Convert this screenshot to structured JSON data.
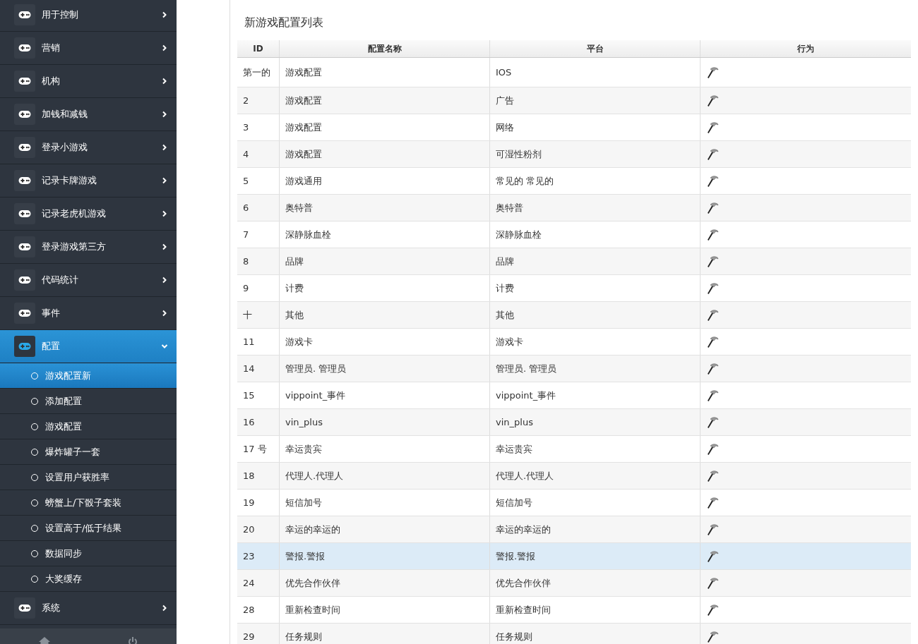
{
  "sidebar": {
    "items": [
      {
        "label": "用于控制",
        "expanded": false,
        "selected": false
      },
      {
        "label": "营销",
        "expanded": false,
        "selected": false
      },
      {
        "label": "机构",
        "expanded": false,
        "selected": false
      },
      {
        "label": "加钱和减钱",
        "expanded": false,
        "selected": false
      },
      {
        "label": "登录小游戏",
        "expanded": false,
        "selected": false
      },
      {
        "label": "记录卡牌游戏",
        "expanded": false,
        "selected": false
      },
      {
        "label": "记录老虎机游戏",
        "expanded": false,
        "selected": false
      },
      {
        "label": "登录游戏第三方",
        "expanded": false,
        "selected": false
      },
      {
        "label": "代码统计",
        "expanded": false,
        "selected": false
      },
      {
        "label": "事件",
        "expanded": false,
        "selected": false
      },
      {
        "label": "配置",
        "expanded": true,
        "selected": true,
        "children": [
          {
            "label": "游戏配置新",
            "selected": true
          },
          {
            "label": "添加配置",
            "selected": false
          },
          {
            "label": "游戏配置",
            "selected": false
          },
          {
            "label": "爆炸罐子一套",
            "selected": false
          },
          {
            "label": "设置用户获胜率",
            "selected": false
          },
          {
            "label": "螃蟹上/下骰子套装",
            "selected": false
          },
          {
            "label": "设置高于/低于结果",
            "selected": false
          },
          {
            "label": "数据同步",
            "selected": false
          },
          {
            "label": "大奖缓存",
            "selected": false
          }
        ]
      },
      {
        "label": "系统",
        "expanded": false,
        "selected": false
      }
    ]
  },
  "page_title": "新游戏配置列表",
  "table": {
    "columns": [
      "ID",
      "配置名称",
      "平台",
      "行为"
    ],
    "rows": [
      {
        "id": "第一的",
        "name": "游戏配置",
        "platform": "IOS",
        "selected": false
      },
      {
        "id": "2",
        "name": "游戏配置",
        "platform": "广告",
        "selected": false
      },
      {
        "id": "3",
        "name": "游戏配置",
        "platform": "网络",
        "selected": false
      },
      {
        "id": "4",
        "name": "游戏配置",
        "platform": "可湿性粉剂",
        "selected": false
      },
      {
        "id": "5",
        "name": "游戏通用",
        "platform": "常见的 常见的",
        "selected": false
      },
      {
        "id": "6",
        "name": "奥特普",
        "platform": "奥特普",
        "selected": false
      },
      {
        "id": "7",
        "name": "深静脉血栓",
        "platform": "深静脉血栓",
        "selected": false
      },
      {
        "id": "8",
        "name": "品牌",
        "platform": "品牌",
        "selected": false
      },
      {
        "id": "9",
        "name": "计费",
        "platform": "计费",
        "selected": false
      },
      {
        "id": "十",
        "name": "其他",
        "platform": "其他",
        "selected": false
      },
      {
        "id": "11",
        "name": "游戏卡",
        "platform": "游戏卡",
        "selected": false
      },
      {
        "id": "14",
        "name": "管理员. 管理员",
        "platform": "管理员. 管理员",
        "selected": false
      },
      {
        "id": "15",
        "name": "vippoint_事件",
        "platform": "vippoint_事件",
        "selected": false
      },
      {
        "id": "16",
        "name": "vin_plus",
        "platform": "vin_plus",
        "selected": false
      },
      {
        "id": "17 号",
        "name": "幸运贵宾",
        "platform": "幸运贵宾",
        "selected": false
      },
      {
        "id": "18",
        "name": "代理人.代理人",
        "platform": "代理人.代理人",
        "selected": false
      },
      {
        "id": "19",
        "name": "短信加号",
        "platform": "短信加号",
        "selected": false
      },
      {
        "id": "20",
        "name": "幸运的幸运的",
        "platform": "幸运的幸运的",
        "selected": false
      },
      {
        "id": "23",
        "name": "警报.警报",
        "platform": "警报.警报",
        "selected": true
      },
      {
        "id": "24",
        "name": "优先合作伙伴",
        "platform": "优先合作伙伴",
        "selected": false
      },
      {
        "id": "28",
        "name": "重新检查时间",
        "platform": "重新检查时间",
        "selected": false
      },
      {
        "id": "29",
        "name": "任务规则",
        "platform": "任务规则",
        "selected": false
      }
    ]
  }
}
